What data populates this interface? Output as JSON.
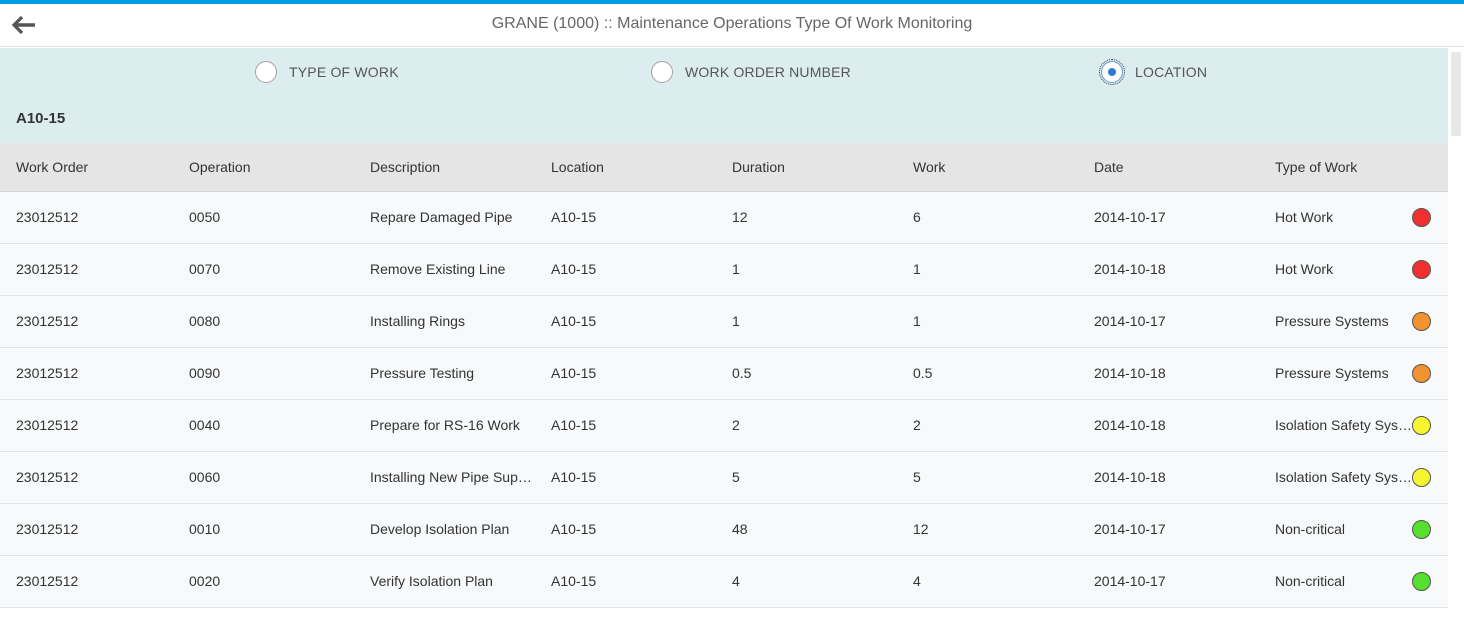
{
  "header": {
    "title": "GRANE (1000) :: Maintenance Operations Type Of Work Monitoring",
    "back_icon": "arrow-left-icon"
  },
  "filter": {
    "options": [
      {
        "label": "TYPE OF WORK",
        "selected": false
      },
      {
        "label": "WORK ORDER NUMBER",
        "selected": false
      },
      {
        "label": "LOCATION",
        "selected": true
      }
    ],
    "group_title": "A10-15"
  },
  "table": {
    "columns": [
      "Work Order",
      "Operation",
      "Description",
      "Location",
      "Duration",
      "Work",
      "Date",
      "Type of Work"
    ],
    "rows": [
      {
        "work_order": "23012512",
        "operation": "0050",
        "description": "Repare Damaged Pipe",
        "location": "A10-15",
        "duration": "12",
        "work": "6",
        "date": "2014-10-17",
        "type_of_work": "Hot Work",
        "status_color": "#f03030"
      },
      {
        "work_order": "23012512",
        "operation": "0070",
        "description": "Remove Existing Line",
        "location": "A10-15",
        "duration": "1",
        "work": "1",
        "date": "2014-10-18",
        "type_of_work": "Hot Work",
        "status_color": "#f03030"
      },
      {
        "work_order": "23012512",
        "operation": "0080",
        "description": "Installing Rings",
        "location": "A10-15",
        "duration": "1",
        "work": "1",
        "date": "2014-10-17",
        "type_of_work": "Pressure Systems",
        "status_color": "#f39230"
      },
      {
        "work_order": "23012512",
        "operation": "0090",
        "description": "Pressure Testing",
        "location": "A10-15",
        "duration": "0.5",
        "work": "0.5",
        "date": "2014-10-18",
        "type_of_work": "Pressure Systems",
        "status_color": "#f39230"
      },
      {
        "work_order": "23012512",
        "operation": "0040",
        "description": "Prepare for RS-16 Work",
        "location": "A10-15",
        "duration": "2",
        "work": "2",
        "date": "2014-10-18",
        "type_of_work": "Isolation Safety Systems",
        "status_color": "#f5f530"
      },
      {
        "work_order": "23012512",
        "operation": "0060",
        "description": "Installing New Pipe Supports",
        "location": "A10-15",
        "duration": "5",
        "work": "5",
        "date": "2014-10-18",
        "type_of_work": "Isolation Safety Systems",
        "status_color": "#f5f530"
      },
      {
        "work_order": "23012512",
        "operation": "0010",
        "description": "Develop Isolation Plan",
        "location": "A10-15",
        "duration": "48",
        "work": "12",
        "date": "2014-10-17",
        "type_of_work": "Non-critical",
        "status_color": "#55e030"
      },
      {
        "work_order": "23012512",
        "operation": "0020",
        "description": "Verify Isolation Plan",
        "location": "A10-15",
        "duration": "4",
        "work": "4",
        "date": "2014-10-17",
        "type_of_work": "Non-critical",
        "status_color": "#55e030"
      }
    ]
  }
}
